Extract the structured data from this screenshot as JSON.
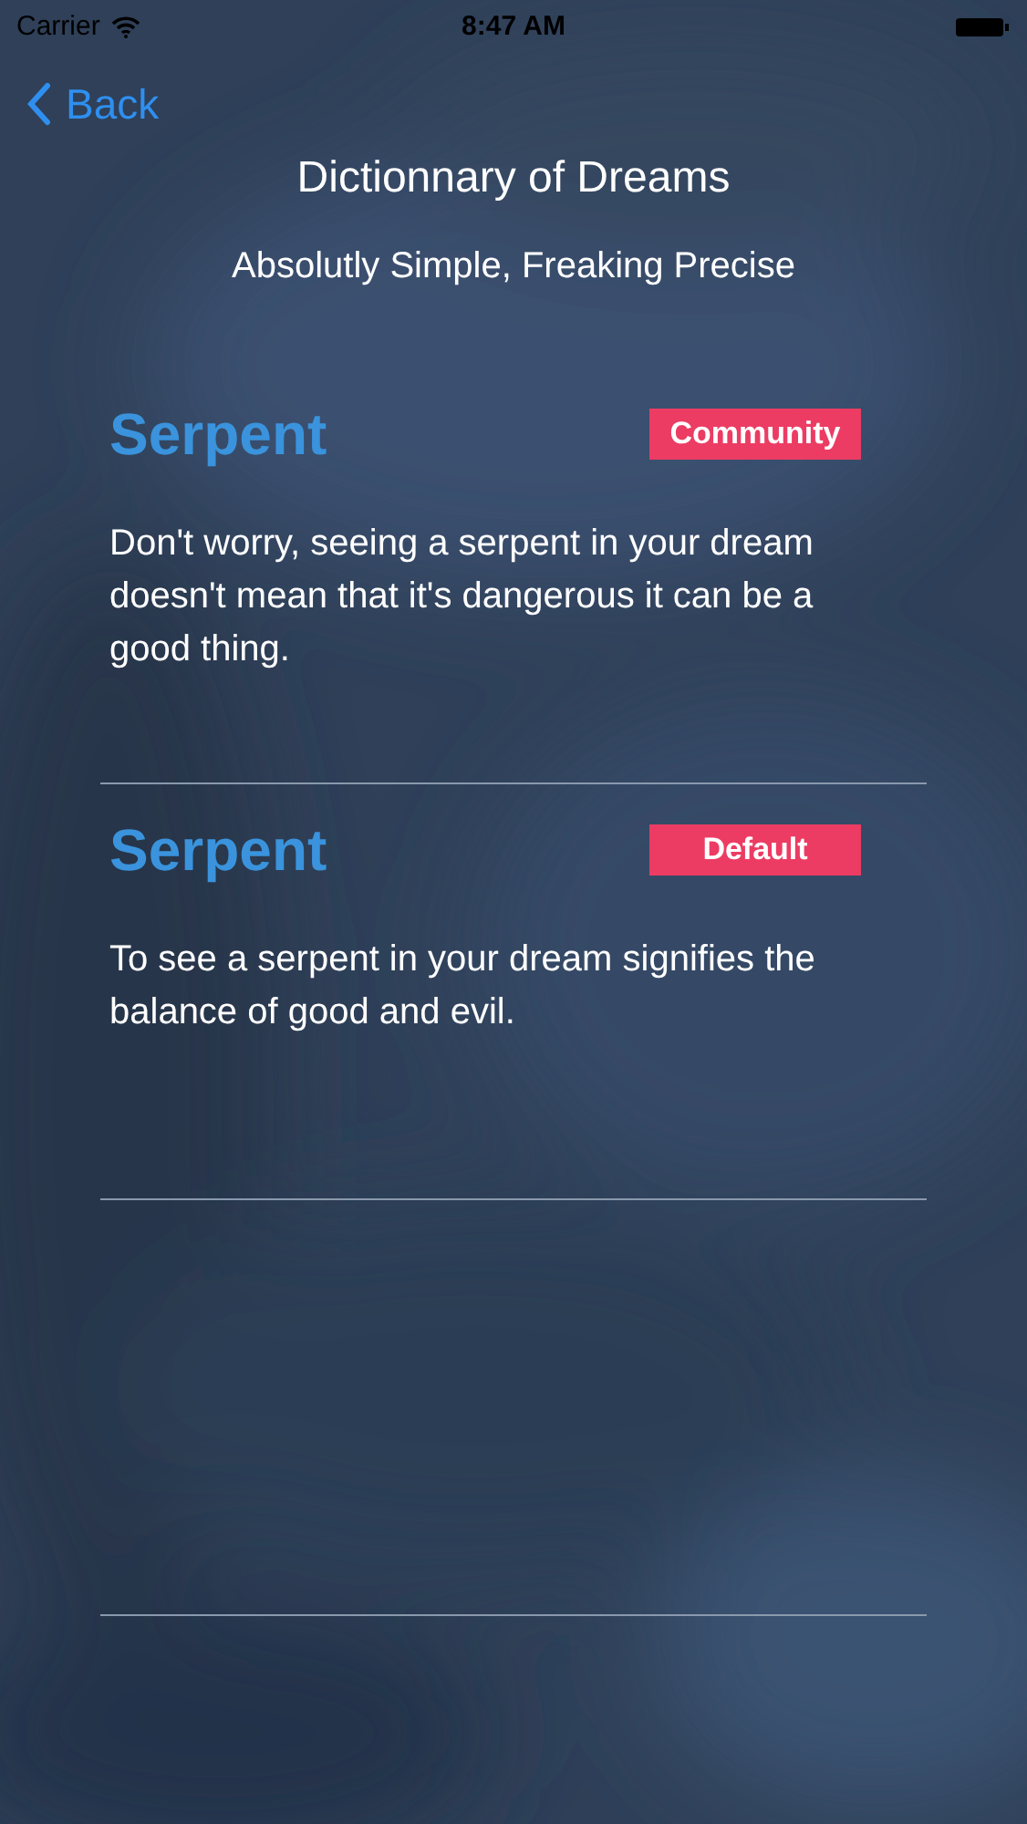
{
  "status_bar": {
    "carrier": "Carrier",
    "time": "8:47 AM"
  },
  "nav": {
    "back": "Back"
  },
  "header": {
    "title": "Dictionnary of Dreams",
    "subtitle": "Absolutly Simple, Freaking Precise"
  },
  "entries": [
    {
      "title": "Serpent",
      "tag": "Community",
      "text": "Don't worry, seeing a serpent in your dream doesn't mean that it's dangerous it can be a good thing."
    },
    {
      "title": "Serpent",
      "tag": "Default",
      "text": "To see a serpent in your dream signifies the balance of good and evil."
    }
  ]
}
